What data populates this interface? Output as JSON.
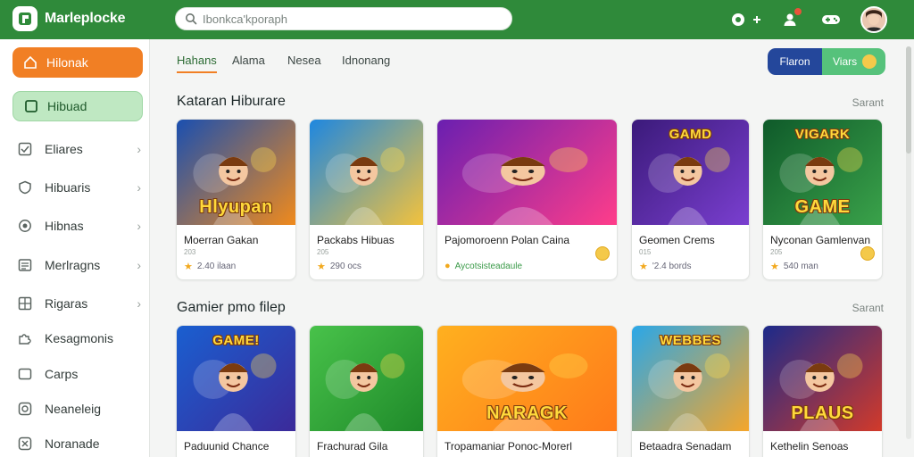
{
  "app": {
    "title": "Marleplocke"
  },
  "search": {
    "placeholder": "Ibonkca'kporaph"
  },
  "header": {
    "notification_count": "",
    "icons": [
      "chat-icon",
      "user-notification-icon",
      "gamepad-icon"
    ]
  },
  "sidebar": {
    "top_buttons": [
      {
        "label": "Hilonak",
        "icon": "home-icon",
        "color": "#f17f24"
      },
      {
        "label": "Hibuad",
        "icon": "square-icon",
        "color": "#bfe8c2"
      }
    ],
    "items": [
      {
        "label": "Eliares",
        "icon": "check-box-icon",
        "chevron": true
      },
      {
        "label": "Hibuaris",
        "icon": "shield-icon",
        "chevron": true
      },
      {
        "label": "Hibnas",
        "icon": "badge-icon",
        "chevron": true
      },
      {
        "label": "Merlragns",
        "icon": "list-icon",
        "chevron": true
      },
      {
        "label": "Rigaras",
        "icon": "grid-icon",
        "chevron": true
      },
      {
        "label": "Kesagmonis",
        "icon": "puzzle-icon",
        "chevron": false
      },
      {
        "label": "Carps",
        "icon": "card-icon",
        "chevron": false
      },
      {
        "label": "Neaneleig",
        "icon": "target-icon",
        "chevron": false
      },
      {
        "label": "Noranade",
        "icon": "trophy-icon",
        "chevron": false
      }
    ]
  },
  "tabs": [
    "Hahans",
    "Alama",
    "Nesea",
    "Idnonang"
  ],
  "toggle": {
    "left": "Flaron",
    "right": "Viars"
  },
  "sections": [
    {
      "title": "Kataran Hiburare",
      "see_all": "Sarant",
      "cards": [
        {
          "title": "Moerran Gakan",
          "sub": "203",
          "meta": "2.40 ilaan",
          "meta_style": "star",
          "banner": "Hlyupan",
          "banner_pos": "bottom",
          "coin": false,
          "bg": [
            "#1a4fb0",
            "#f08a1c"
          ]
        },
        {
          "title": "Packabs Hibuas",
          "sub": "205",
          "meta": "290 ocs",
          "meta_style": "star",
          "banner": "",
          "banner_pos": "bottom",
          "coin": false,
          "bg": [
            "#1e87e0",
            "#f3c23c"
          ]
        },
        {
          "title": "Pajomoroenn Polan Caina",
          "sub": "",
          "meta": "Aycotsisteadaule",
          "meta_style": "green",
          "banner": "",
          "banner_pos": "bottom",
          "coin": true,
          "bg": [
            "#6a1fb0",
            "#ff3d8a"
          ]
        },
        {
          "title": "Geomen Crems",
          "sub": "015",
          "meta": "'2.4 bords",
          "meta_style": "star",
          "banner": "GAMD",
          "banner_pos": "top",
          "coin": false,
          "bg": [
            "#3b1a7a",
            "#7a3fd0"
          ]
        },
        {
          "title": "Nyconan Gamlenvan",
          "sub": "205",
          "meta": "540 man",
          "meta_style": "star",
          "banner": "GAME",
          "banner_pos": "bottom",
          "coin": true,
          "bg": [
            "#0f5a2a",
            "#3aa24a"
          ],
          "top_banner": "VIGARK"
        }
      ]
    },
    {
      "title": "Gamier pmo filep",
      "see_all": "Sarant",
      "cards": [
        {
          "title": "Paduunid Chance",
          "sub": "",
          "meta": "",
          "meta_style": "star",
          "banner": "GAME!",
          "banner_pos": "top",
          "coin": false,
          "bg": [
            "#1a5fd0",
            "#3b2a9a"
          ]
        },
        {
          "title": "Frachurad Gila",
          "sub": "",
          "meta": "",
          "meta_style": "star",
          "banner": "",
          "banner_pos": "bottom",
          "coin": false,
          "bg": [
            "#48c24a",
            "#1f8a2a"
          ]
        },
        {
          "title": "Tropamaniar Ponoc-Morerl",
          "sub": "",
          "meta": "",
          "meta_style": "star",
          "banner": "NARAGK",
          "banner_pos": "bottom",
          "coin": false,
          "bg": [
            "#ffb01f",
            "#ff7a1a"
          ]
        },
        {
          "title": "Betaadra Senadam",
          "sub": "",
          "meta": "",
          "meta_style": "star",
          "banner": "WEBBES",
          "banner_pos": "top",
          "coin": false,
          "bg": [
            "#2aa7e8",
            "#f5a62a"
          ]
        },
        {
          "title": "Kethelin Senoas",
          "sub": "",
          "meta": "",
          "meta_style": "star",
          "banner": "PLAUS",
          "banner_pos": "bottom",
          "coin": false,
          "bg": [
            "#1c2a8a",
            "#d23a2a"
          ]
        }
      ]
    }
  ]
}
